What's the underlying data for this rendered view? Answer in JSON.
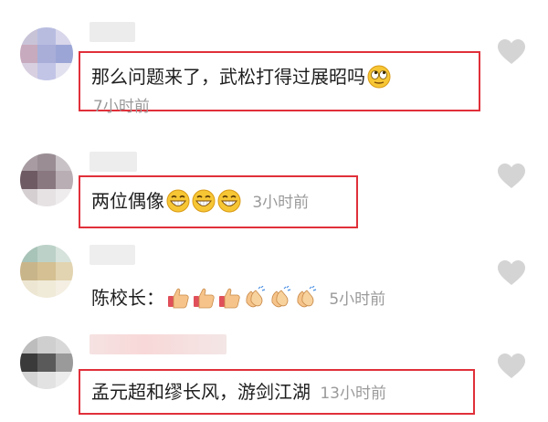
{
  "comments": [
    {
      "text": "那么问题来了，武松打得过展昭吗",
      "time": "7小时前",
      "emojis": [
        "rolling-eyes"
      ]
    },
    {
      "text": "两位偶像",
      "time": "3小时前",
      "emojis": [
        "grin",
        "grin",
        "grin"
      ]
    },
    {
      "text": "陈校长：",
      "time": "5小时前",
      "emojis": [
        "thumbs-up",
        "thumbs-up",
        "thumbs-up",
        "clap",
        "clap",
        "clap"
      ]
    },
    {
      "text": "孟元超和缪长风，游剑江湖",
      "time": "13小时前",
      "emojis": []
    }
  ],
  "colors": {
    "highlight": "#e0303a",
    "timestamp": "#9a9a9a",
    "heart": "#d4d4d4"
  }
}
